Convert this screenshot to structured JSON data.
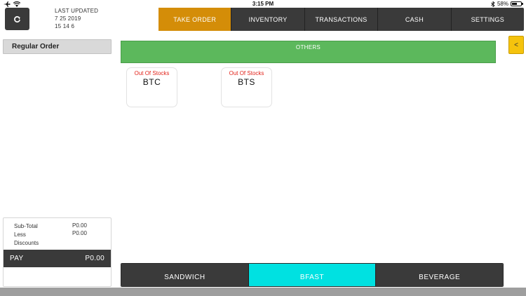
{
  "status_bar": {
    "time": "3:15 PM",
    "battery_percent": "58%",
    "battery_level": 0.58
  },
  "header": {
    "last_updated_label": "LAST UPDATED",
    "last_updated_date": "7 25 2019",
    "last_updated_time": "15 14 6"
  },
  "topnav": {
    "tabs": [
      {
        "label": "TAKE ORDER",
        "active": true
      },
      {
        "label": "INVENTORY",
        "active": false
      },
      {
        "label": "TRANSACTIONS",
        "active": false
      },
      {
        "label": "CASH",
        "active": false
      },
      {
        "label": "SETTINGS",
        "active": false
      }
    ]
  },
  "left_panel": {
    "order_type": "Regular Order",
    "summary": {
      "subtotal_label": "Sub-Total",
      "subtotal_value": "P0.00",
      "less_label": "Less",
      "less_value": "P0.00",
      "discounts_label": "Discounts"
    },
    "pay": {
      "label": "PAY",
      "amount": "P0.00"
    }
  },
  "main": {
    "category_banner": "OTHERS",
    "collapse_glyph": "<",
    "products": [
      {
        "stock_status": "Out Of Stocks",
        "name": "BTC"
      },
      {
        "stock_status": "Out Of Stocks",
        "name": "BTS"
      }
    ]
  },
  "bottom_tabs": [
    {
      "label": "SANDWICH",
      "active": false
    },
    {
      "label": "BFAST",
      "active": true
    },
    {
      "label": "BEVERAGE",
      "active": false
    }
  ],
  "colors": {
    "accent_orange": "#d48d08",
    "category_green": "#5cb85c",
    "active_cyan": "#00e1e1",
    "dark_bar": "#3a3a3a",
    "out_of_stock_red": "#e2231a",
    "collapse_yellow": "#f5c30d"
  },
  "icons": {
    "status_left": [
      "airplane-icon",
      "wifi-icon"
    ],
    "status_right": [
      "bluetooth-icon",
      "battery-icon"
    ],
    "refresh": "refresh-icon",
    "collapse": "chevron-left-icon"
  }
}
